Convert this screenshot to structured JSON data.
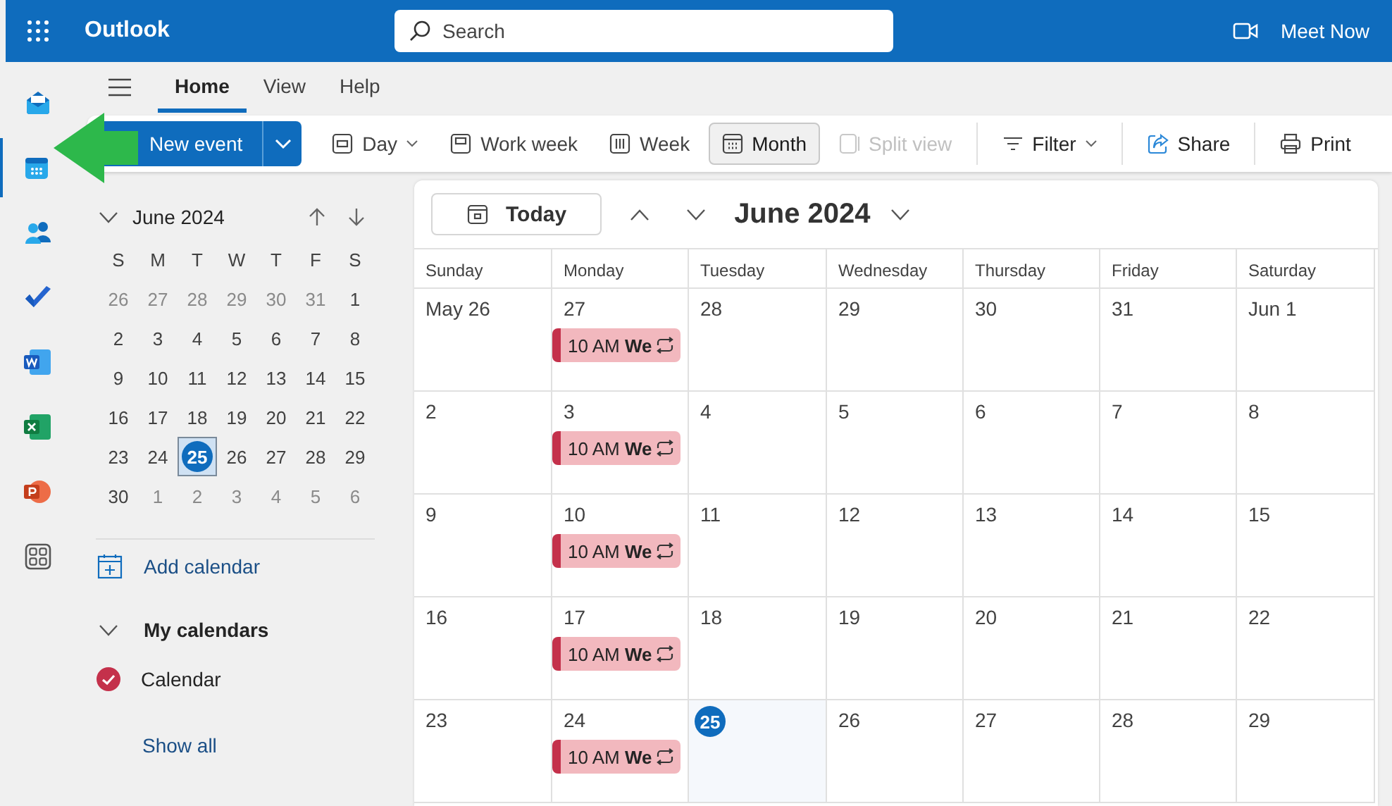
{
  "app": {
    "name": "Outlook",
    "search": {
      "placeholder": "Search"
    },
    "meet_now": "Meet Now"
  },
  "rail": [
    {
      "kind": "mail",
      "selected": false
    },
    {
      "kind": "calendar",
      "selected": true
    },
    {
      "kind": "people",
      "selected": false
    },
    {
      "kind": "todo",
      "selected": false
    },
    {
      "kind": "word",
      "selected": false
    },
    {
      "kind": "excel",
      "selected": false
    },
    {
      "kind": "powerpoint",
      "selected": false
    },
    {
      "kind": "apps",
      "selected": false
    }
  ],
  "ribbon_tabs": [
    {
      "label": "Home",
      "selected": true
    },
    {
      "label": "View",
      "selected": false
    },
    {
      "label": "Help",
      "selected": false
    }
  ],
  "new_event": {
    "label": "New event"
  },
  "view_buttons": [
    {
      "kind": "day",
      "label": "Day",
      "selected": false,
      "dropdown": true
    },
    {
      "kind": "workweek",
      "label": "Work week",
      "selected": false,
      "dropdown": false
    },
    {
      "kind": "week",
      "label": "Week",
      "selected": false,
      "dropdown": false
    },
    {
      "kind": "month",
      "label": "Month",
      "selected": true,
      "dropdown": false
    }
  ],
  "split_view": {
    "label": "Split view",
    "disabled": true
  },
  "actions": [
    {
      "kind": "filter",
      "label": "Filter",
      "dropdown": true
    },
    {
      "kind": "share",
      "label": "Share",
      "dropdown": false
    },
    {
      "kind": "print",
      "label": "Print",
      "dropdown": false
    }
  ],
  "mini_calendar": {
    "title": "June 2024",
    "weekdays": [
      "S",
      "M",
      "T",
      "W",
      "T",
      "F",
      "S"
    ],
    "weeks": [
      [
        {
          "day": "26",
          "muted": true,
          "selected": false
        },
        {
          "day": "27",
          "muted": true,
          "selected": false
        },
        {
          "day": "28",
          "muted": true,
          "selected": false
        },
        {
          "day": "29",
          "muted": true,
          "selected": false
        },
        {
          "day": "30",
          "muted": true,
          "selected": false
        },
        {
          "day": "31",
          "muted": true,
          "selected": false
        },
        {
          "day": "1",
          "muted": false,
          "selected": false
        }
      ],
      [
        {
          "day": "2",
          "muted": false,
          "selected": false
        },
        {
          "day": "3",
          "muted": false,
          "selected": false
        },
        {
          "day": "4",
          "muted": false,
          "selected": false
        },
        {
          "day": "5",
          "muted": false,
          "selected": false
        },
        {
          "day": "6",
          "muted": false,
          "selected": false
        },
        {
          "day": "7",
          "muted": false,
          "selected": false
        },
        {
          "day": "8",
          "muted": false,
          "selected": false
        }
      ],
      [
        {
          "day": "9",
          "muted": false,
          "selected": false
        },
        {
          "day": "10",
          "muted": false,
          "selected": false
        },
        {
          "day": "11",
          "muted": false,
          "selected": false
        },
        {
          "day": "12",
          "muted": false,
          "selected": false
        },
        {
          "day": "13",
          "muted": false,
          "selected": false
        },
        {
          "day": "14",
          "muted": false,
          "selected": false
        },
        {
          "day": "15",
          "muted": false,
          "selected": false
        }
      ],
      [
        {
          "day": "16",
          "muted": false,
          "selected": false
        },
        {
          "day": "17",
          "muted": false,
          "selected": false
        },
        {
          "day": "18",
          "muted": false,
          "selected": false
        },
        {
          "day": "19",
          "muted": false,
          "selected": false
        },
        {
          "day": "20",
          "muted": false,
          "selected": false
        },
        {
          "day": "21",
          "muted": false,
          "selected": false
        },
        {
          "day": "22",
          "muted": false,
          "selected": false
        }
      ],
      [
        {
          "day": "23",
          "muted": false,
          "selected": false
        },
        {
          "day": "24",
          "muted": false,
          "selected": false
        },
        {
          "day": "25",
          "muted": false,
          "selected": true
        },
        {
          "day": "26",
          "muted": false,
          "selected": false
        },
        {
          "day": "27",
          "muted": false,
          "selected": false
        },
        {
          "day": "28",
          "muted": false,
          "selected": false
        },
        {
          "day": "29",
          "muted": false,
          "selected": false
        }
      ],
      [
        {
          "day": "30",
          "muted": false,
          "selected": false
        },
        {
          "day": "1",
          "muted": true,
          "selected": false
        },
        {
          "day": "2",
          "muted": true,
          "selected": false
        },
        {
          "day": "3",
          "muted": true,
          "selected": false
        },
        {
          "day": "4",
          "muted": true,
          "selected": false
        },
        {
          "day": "5",
          "muted": true,
          "selected": false
        },
        {
          "day": "6",
          "muted": true,
          "selected": false
        }
      ]
    ]
  },
  "add_calendar": "Add calendar",
  "my_calendars": {
    "title": "My calendars",
    "expanded": true,
    "items": [
      {
        "name": "Calendar",
        "checked": true,
        "color": "#c4314b"
      }
    ],
    "show_all": "Show all"
  },
  "month_view": {
    "today_button": "Today",
    "title": "June 2024",
    "weekdays": [
      "Sunday",
      "Monday",
      "Tuesday",
      "Wednesday",
      "Thursday",
      "Friday",
      "Saturday"
    ],
    "weeks": [
      [
        {
          "label": "May 26",
          "today": false
        },
        {
          "label": "27",
          "today": false,
          "events": [
            {
              "time": "10 AM",
              "title": "We",
              "recurring": true
            }
          ]
        },
        {
          "label": "28",
          "today": false
        },
        {
          "label": "29",
          "today": false
        },
        {
          "label": "30",
          "today": false
        },
        {
          "label": "31",
          "today": false
        },
        {
          "label": "Jun 1",
          "today": false
        }
      ],
      [
        {
          "label": "2",
          "today": false
        },
        {
          "label": "3",
          "today": false,
          "events": [
            {
              "time": "10 AM",
              "title": "We",
              "recurring": true
            }
          ]
        },
        {
          "label": "4",
          "today": false
        },
        {
          "label": "5",
          "today": false
        },
        {
          "label": "6",
          "today": false
        },
        {
          "label": "7",
          "today": false
        },
        {
          "label": "8",
          "today": false
        }
      ],
      [
        {
          "label": "9",
          "today": false
        },
        {
          "label": "10",
          "today": false,
          "events": [
            {
              "time": "10 AM",
              "title": "We",
              "recurring": true
            }
          ]
        },
        {
          "label": "11",
          "today": false
        },
        {
          "label": "12",
          "today": false
        },
        {
          "label": "13",
          "today": false
        },
        {
          "label": "14",
          "today": false
        },
        {
          "label": "15",
          "today": false
        }
      ],
      [
        {
          "label": "16",
          "today": false
        },
        {
          "label": "17",
          "today": false,
          "events": [
            {
              "time": "10 AM",
              "title": "We",
              "recurring": true
            }
          ]
        },
        {
          "label": "18",
          "today": false
        },
        {
          "label": "19",
          "today": false
        },
        {
          "label": "20",
          "today": false
        },
        {
          "label": "21",
          "today": false
        },
        {
          "label": "22",
          "today": false
        }
      ],
      [
        {
          "label": "23",
          "today": false
        },
        {
          "label": "24",
          "today": false,
          "events": [
            {
              "time": "10 AM",
              "title": "We",
              "recurring": true
            }
          ]
        },
        {
          "label": "25",
          "today": true
        },
        {
          "label": "26",
          "today": false
        },
        {
          "label": "27",
          "today": false
        },
        {
          "label": "28",
          "today": false
        },
        {
          "label": "29",
          "today": false
        }
      ]
    ]
  }
}
